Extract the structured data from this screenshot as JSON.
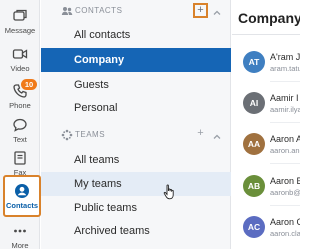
{
  "rail": {
    "items": [
      {
        "label": "Message",
        "icon": "message-icon"
      },
      {
        "label": "Video",
        "icon": "video-icon"
      },
      {
        "label": "Phone",
        "icon": "phone-icon",
        "badge": "10"
      },
      {
        "label": "Text",
        "icon": "text-icon"
      },
      {
        "label": "Fax",
        "icon": "fax-icon"
      },
      {
        "label": "Contacts",
        "icon": "contacts-icon",
        "active": true
      },
      {
        "label": "More",
        "icon": "more-icon"
      }
    ]
  },
  "contacts_section": {
    "title": "CONTACTS",
    "add_label": "+",
    "items": [
      {
        "label": "All contacts"
      },
      {
        "label": "Company",
        "selected": true
      },
      {
        "label": "Guests"
      },
      {
        "label": "Personal"
      }
    ]
  },
  "teams_section": {
    "title": "TEAMS",
    "add_label": "+",
    "items": [
      {
        "label": "All teams"
      },
      {
        "label": "My teams",
        "hovered": true
      },
      {
        "label": "Public teams"
      },
      {
        "label": "Archived teams"
      }
    ]
  },
  "main": {
    "title": "Company",
    "contacts": [
      {
        "initials": "AT",
        "name": "A'ram J",
        "email": "aram.tatu",
        "color": "#3f7fc1"
      },
      {
        "initials": "AI",
        "name": "Aamir I",
        "email": "aamir.ilya",
        "color": "#6b6f75"
      },
      {
        "initials": "AA",
        "name": "Aaron A",
        "email": "aaron.and",
        "color": "#a0713f"
      },
      {
        "initials": "AB",
        "name": "Aaron B",
        "email": "aaronb@",
        "color": "#6a8f3a"
      },
      {
        "initials": "AC",
        "name": "Aaron C",
        "email": "aaron.cla",
        "color": "#5b6cc1"
      }
    ]
  },
  "colors": {
    "accent": "#1565b5",
    "highlight": "#d9822b",
    "badge": "#f07a1a"
  }
}
